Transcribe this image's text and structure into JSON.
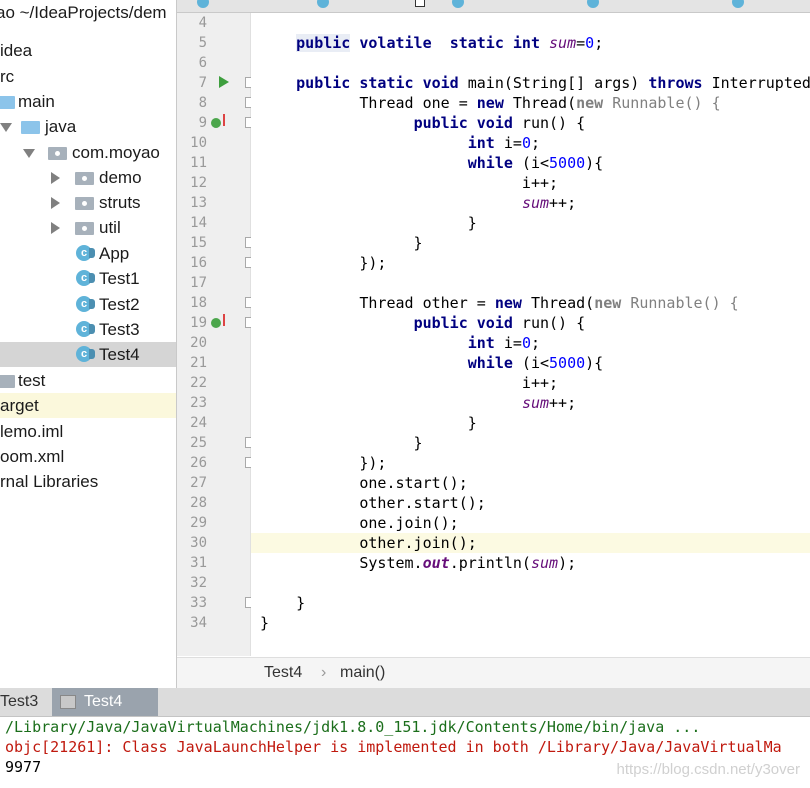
{
  "project_tree": {
    "rows": [
      {
        "label": "ao ~/IdeaProjects/dem",
        "icon": "folder-icon"
      },
      {
        "label": "idea",
        "icon": "folder-icon"
      },
      {
        "label": "rc",
        "icon": "folder-icon"
      },
      {
        "label": "main",
        "icon": "folder-icon"
      },
      {
        "label": "java",
        "icon": "folder-icon"
      },
      {
        "label": "com.moyao",
        "icon": "package-icon"
      },
      {
        "label": "demo",
        "icon": "package-icon"
      },
      {
        "label": "struts",
        "icon": "package-icon"
      },
      {
        "label": "util",
        "icon": "package-icon"
      },
      {
        "label": "App",
        "icon": "class-icon"
      },
      {
        "label": "Test1",
        "icon": "class-icon"
      },
      {
        "label": "Test2",
        "icon": "class-icon"
      },
      {
        "label": "Test3",
        "icon": "class-icon"
      },
      {
        "label": "Test4",
        "icon": "class-icon",
        "selected": true
      },
      {
        "label": "test",
        "icon": "folder-icon"
      },
      {
        "label": "arget",
        "icon": "folder-icon",
        "highlighted": true
      },
      {
        "label": "lemo.iml",
        "icon": "file-icon"
      },
      {
        "label": "oom.xml",
        "icon": "file-icon"
      },
      {
        "label": "rnal Libraries",
        "icon": "library-icon"
      }
    ]
  },
  "editor": {
    "line_numbers": [
      "4",
      "5",
      "6",
      "7",
      "8",
      "9",
      "10",
      "11",
      "12",
      "13",
      "14",
      "15",
      "16",
      "17",
      "18",
      "19",
      "20",
      "21",
      "22",
      "23",
      "24",
      "25",
      "26",
      "27",
      "28",
      "29",
      "30",
      "31",
      "32",
      "33",
      "34"
    ],
    "current_line": "30"
  },
  "breadcrumb": {
    "class": "Test4",
    "sep": "›",
    "method": "main()"
  },
  "run_tabs": [
    {
      "label": "Test3"
    },
    {
      "label": "Test4",
      "active": true
    }
  ],
  "console": {
    "cmd": "/Library/Java/JavaVirtualMachines/jdk1.8.0_151.jdk/Contents/Home/bin/java ...",
    "err": "objc[21261]: Class JavaLaunchHelper is implemented in both /Library/Java/JavaVirtualMa",
    "out": "9977"
  },
  "watermark": "https://blog.csdn.net/y3over",
  "colors": {
    "keyword": "#000080",
    "number": "#0000ff",
    "field": "#660e7a",
    "selection": "#d5d5d5"
  }
}
